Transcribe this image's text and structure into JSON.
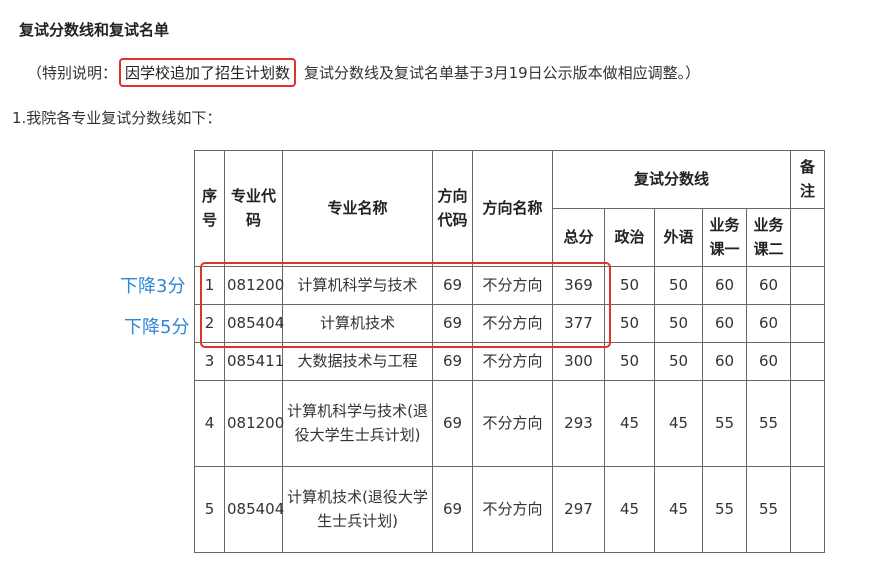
{
  "heading": "复试分数线和复试名单",
  "notice": {
    "prefix": "（特别说明：",
    "highlight": "因学校追加了招生计划数",
    "suffix": "复试分数线及复试名单基于3月19日公示版本做相应调整。）"
  },
  "intro": "1.我院各专业复试分数线如下：",
  "table": {
    "headers": {
      "seq": "序号",
      "code": "专业代码",
      "name": "专业名称",
      "dir_code": "方向代码",
      "dir_name": "方向名称",
      "score_group": "复试分数线",
      "remark": "备注",
      "total": "总分",
      "politics": "政治",
      "foreign": "外语",
      "course1": "业务课一",
      "course2": "业务课二"
    },
    "rows": [
      {
        "seq": "1",
        "code": "081200",
        "name": "计算机科学与技术",
        "dir_code": "69",
        "dir_name": "不分方向",
        "total": "369",
        "politics": "50",
        "foreign": "50",
        "course1": "60",
        "course2": "60",
        "remark": ""
      },
      {
        "seq": "2",
        "code": "085404",
        "name": "计算机技术",
        "dir_code": "69",
        "dir_name": "不分方向",
        "total": "377",
        "politics": "50",
        "foreign": "50",
        "course1": "60",
        "course2": "60",
        "remark": ""
      },
      {
        "seq": "3",
        "code": "085411",
        "name": "大数据技术与工程",
        "dir_code": "69",
        "dir_name": "不分方向",
        "total": "300",
        "politics": "50",
        "foreign": "50",
        "course1": "60",
        "course2": "60",
        "remark": ""
      },
      {
        "seq": "4",
        "code": "081200",
        "name": "计算机科学与技术(退役大学生士兵计划)",
        "dir_code": "69",
        "dir_name": "不分方向",
        "total": "293",
        "politics": "45",
        "foreign": "45",
        "course1": "55",
        "course2": "55",
        "remark": ""
      },
      {
        "seq": "5",
        "code": "085404",
        "name": "计算机技术(退役大学生士兵计划)",
        "dir_code": "69",
        "dir_name": "不分方向",
        "total": "297",
        "politics": "45",
        "foreign": "45",
        "course1": "55",
        "course2": "55",
        "remark": ""
      }
    ]
  },
  "annotations": {
    "row1": "下降3分",
    "row2": "下降5分",
    "color": "#2f86d6",
    "box_color": "#e0312b"
  }
}
